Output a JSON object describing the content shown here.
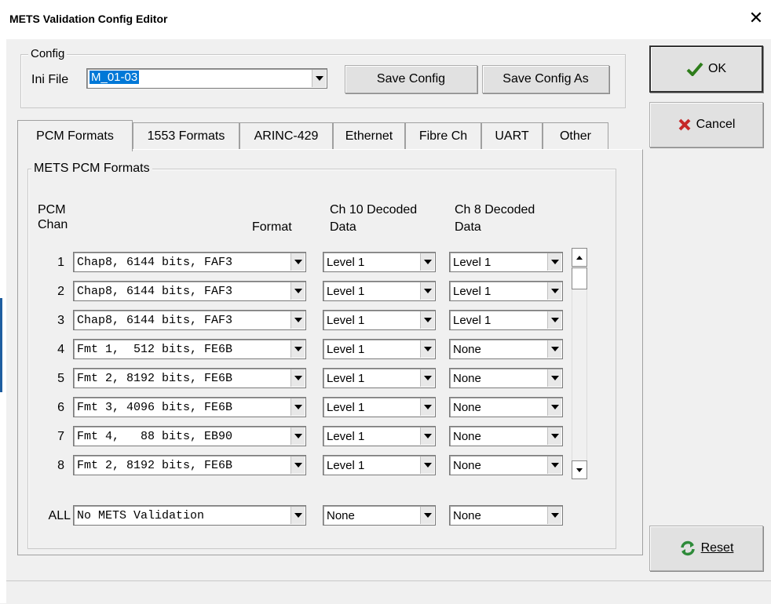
{
  "window": {
    "title": "METS Validation Config Editor",
    "close_glyph": "✕"
  },
  "config": {
    "group_label": "Config",
    "ini_label": "Ini File",
    "ini_value": "M_01-03",
    "save_label": "Save Config",
    "save_as_label": "Save Config As"
  },
  "buttons": {
    "ok": "OK",
    "cancel": "Cancel",
    "reset": "Reset",
    "ok_icon_color": "#2e7d1b",
    "cancel_icon_color": "#c62828",
    "reset_icon_color": "#2e8b3a"
  },
  "tabs": [
    "PCM Formats",
    "1553 Formats",
    "ARINC-429",
    "Ethernet",
    "Fibre Ch",
    "UART",
    "Other"
  ],
  "active_tab": "PCM Formats",
  "pcm": {
    "group_label": "METS PCM Formats",
    "headers": {
      "pcm": "PCM",
      "chan": "Chan",
      "format": "Format",
      "ch10_line1": "Ch 10 Decoded",
      "ch10_line2": "Data",
      "ch8_line1": "Ch 8 Decoded",
      "ch8_line2": "Data"
    },
    "rows": [
      {
        "chan": "1",
        "format": "Chap8, 6144 bits, FAF3",
        "ch10": "Level 1",
        "ch8": "Level 1"
      },
      {
        "chan": "2",
        "format": "Chap8, 6144 bits, FAF3",
        "ch10": "Level 1",
        "ch8": "Level 1"
      },
      {
        "chan": "3",
        "format": "Chap8, 6144 bits, FAF3",
        "ch10": "Level 1",
        "ch8": "Level 1"
      },
      {
        "chan": "4",
        "format": "Fmt 1,  512 bits, FE6B",
        "ch10": "Level 1",
        "ch8": "None"
      },
      {
        "chan": "5",
        "format": "Fmt 2, 8192 bits, FE6B",
        "ch10": "Level 1",
        "ch8": "None"
      },
      {
        "chan": "6",
        "format": "Fmt 3, 4096 bits, FE6B",
        "ch10": "Level 1",
        "ch8": "None"
      },
      {
        "chan": "7",
        "format": "Fmt 4,   88 bits, EB90",
        "ch10": "Level 1",
        "ch8": "None"
      },
      {
        "chan": "8",
        "format": "Fmt 2, 8192 bits, FE6B",
        "ch10": "Level 1",
        "ch8": "None"
      }
    ],
    "all": {
      "label": "ALL",
      "format": "No METS Validation",
      "ch10": "None",
      "ch8": "None"
    }
  }
}
